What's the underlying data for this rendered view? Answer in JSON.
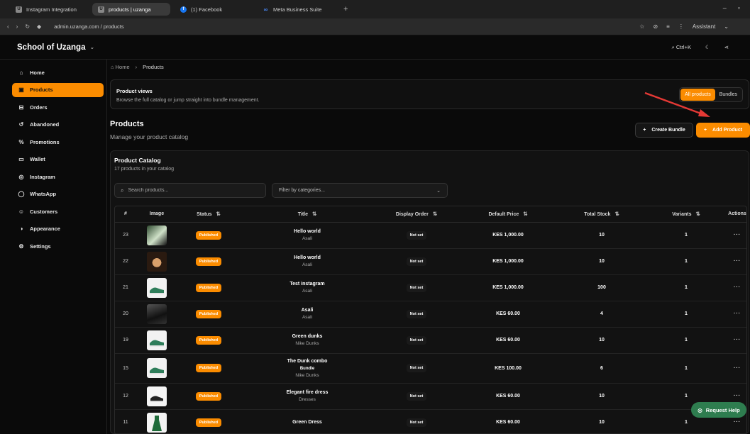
{
  "browser": {
    "tabs": [
      {
        "title": "Instagram Integration",
        "icon": "U"
      },
      {
        "title": "products | uzanga",
        "icon": "U"
      },
      {
        "title": "(1) Facebook",
        "icon": "f"
      },
      {
        "title": "Meta Business Suite",
        "icon": "∞"
      }
    ],
    "new_tab": "+",
    "url": "admin.uzanga.com / products",
    "assistant": "Assistant"
  },
  "header": {
    "brand": "School of Uzanga",
    "shortcut": "Ctrl+K"
  },
  "sidebar": {
    "items": [
      {
        "label": "Home",
        "icon": "home-icon",
        "glyph": "⌂"
      },
      {
        "label": "Products",
        "icon": "box-icon",
        "glyph": "▣"
      },
      {
        "label": "Orders",
        "icon": "cart-icon",
        "glyph": "⊟"
      },
      {
        "label": "Abandoned",
        "icon": "refresh-icon",
        "glyph": "↺"
      },
      {
        "label": "Promotions",
        "icon": "percent-icon",
        "glyph": "%"
      },
      {
        "label": "Wallet",
        "icon": "wallet-icon",
        "glyph": "▭"
      },
      {
        "label": "Instagram",
        "icon": "instagram-icon",
        "glyph": "◎"
      },
      {
        "label": "WhatsApp",
        "icon": "whatsapp-icon",
        "glyph": "◯"
      },
      {
        "label": "Customers",
        "icon": "users-icon",
        "glyph": "☺"
      },
      {
        "label": "Appearance",
        "icon": "palette-icon",
        "glyph": "◑"
      },
      {
        "label": "Settings",
        "icon": "gear-icon",
        "glyph": "⚙"
      }
    ],
    "active": "Products"
  },
  "breadcrumb": {
    "home": "Home",
    "current": "Products"
  },
  "views": {
    "title": "Product views",
    "description": "Browse the full catalog or jump straight into bundle management.",
    "all_label": "All products",
    "bundles_label": "Bundles"
  },
  "page": {
    "title": "Products",
    "subtitle": "Manage your product catalog",
    "create_bundle": "Create Bundle",
    "add_product": "Add Product"
  },
  "catalog": {
    "title": "Product Catalog",
    "subtitle": "17 products in your catalog",
    "search_placeholder": "Search products...",
    "filter_placeholder": "Filter by categories..."
  },
  "table": {
    "headers": [
      "#",
      "Image",
      "Status",
      "Title",
      "Display Order",
      "Default Price",
      "Total Stock",
      "Variants",
      "Actions"
    ],
    "rows": [
      {
        "id": "23",
        "status": "Published",
        "title": "Hello world",
        "category": "Asali",
        "bundle": "",
        "order": "Not set",
        "price": "KES 1,000.00",
        "stock": "10",
        "variants": "1",
        "img": "green"
      },
      {
        "id": "22",
        "status": "Published",
        "title": "Hello world",
        "category": "Asali",
        "bundle": "",
        "order": "Not set",
        "price": "KES 1,000.00",
        "stock": "10",
        "variants": "1",
        "img": "face"
      },
      {
        "id": "21",
        "status": "Published",
        "title": "Test instagram",
        "category": "Asali",
        "bundle": "",
        "order": "Not set",
        "price": "KES 1,000.00",
        "stock": "100",
        "variants": "1",
        "img": "shoe"
      },
      {
        "id": "20",
        "status": "Published",
        "title": "Asali",
        "category": "Asali",
        "bundle": "",
        "order": "Not set",
        "price": "KES 60.00",
        "stock": "4",
        "variants": "1",
        "img": "dark"
      },
      {
        "id": "19",
        "status": "Published",
        "title": "Green dunks",
        "category": "Nike Dunks",
        "bundle": "",
        "order": "Not set",
        "price": "KES 60.00",
        "stock": "10",
        "variants": "1",
        "img": "shoe"
      },
      {
        "id": "15",
        "status": "Published",
        "title": "The Dunk combo",
        "category": "Nike Dunks",
        "bundle": "Bundle",
        "order": "Not set",
        "price": "KES 100.00",
        "stock": "6",
        "variants": "1",
        "img": "shoe"
      },
      {
        "id": "12",
        "status": "Published",
        "title": "Elegant fire dress",
        "category": "Dresses",
        "bundle": "",
        "order": "Not set",
        "price": "KES 60.00",
        "stock": "10",
        "variants": "1",
        "img": "sneaker"
      },
      {
        "id": "11",
        "status": "Published",
        "title": "Green Dress",
        "category": "",
        "bundle": "",
        "order": "Not set",
        "price": "KES 60.00",
        "stock": "10",
        "variants": "1",
        "img": "dress"
      }
    ]
  },
  "help": "Request Help",
  "colors": {
    "accent": "#fb8c00",
    "help": "#2e7d4f",
    "arrow": "#e53935"
  }
}
